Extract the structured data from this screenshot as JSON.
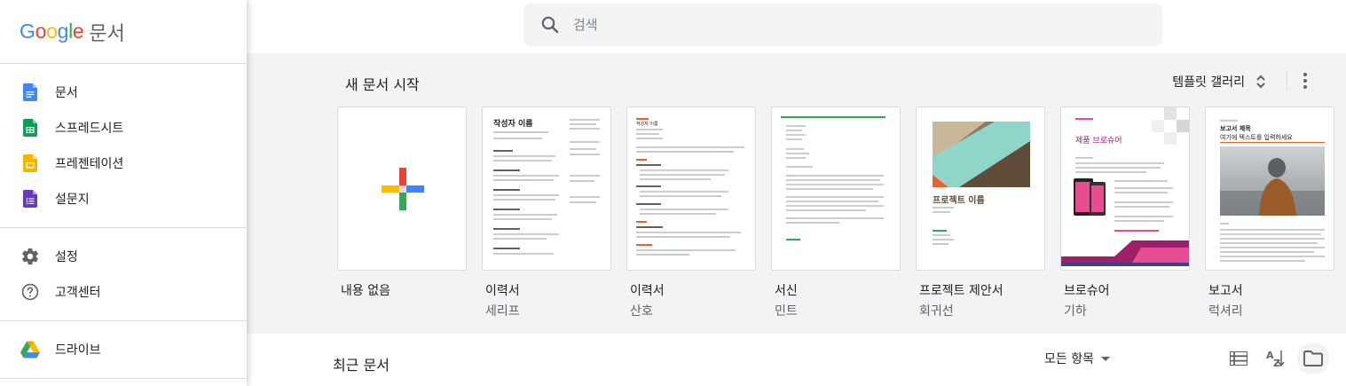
{
  "brand": {
    "logo_letters": [
      "G",
      "o",
      "o",
      "g",
      "l",
      "e"
    ],
    "logo_colors": [
      "#4285F4",
      "#EA4335",
      "#FBBC05",
      "#4285F4",
      "#34A853",
      "#EA4335"
    ],
    "product": "문서"
  },
  "sidebar": {
    "apps": [
      {
        "label": "문서",
        "icon": "docs-icon",
        "color": "#4285F4"
      },
      {
        "label": "스프레드시트",
        "icon": "sheets-icon",
        "color": "#0F9D58"
      },
      {
        "label": "프레젠테이션",
        "icon": "slides-icon",
        "color": "#F4B400"
      },
      {
        "label": "설문지",
        "icon": "forms-icon",
        "color": "#673AB7"
      }
    ],
    "settings": [
      {
        "label": "설정",
        "icon": "gear-icon"
      },
      {
        "label": "고객센터",
        "icon": "help-icon"
      }
    ],
    "drive": {
      "label": "드라이브",
      "icon": "drive-icon"
    }
  },
  "search": {
    "placeholder": "검색"
  },
  "templates": {
    "title": "새 문서 시작",
    "gallery_label": "템플릿 갤러리",
    "items": [
      {
        "name": "내용 없음",
        "sub": ""
      },
      {
        "name": "이력서",
        "sub": "세리프",
        "heading": "작성자 이름"
      },
      {
        "name": "이력서",
        "sub": "산호",
        "heading": "작성자 이름"
      },
      {
        "name": "서신",
        "sub": "민트"
      },
      {
        "name": "프로젝트 제안서",
        "sub": "회귀선",
        "heading": "프로젝트 이름"
      },
      {
        "name": "브로슈어",
        "sub": "기하",
        "heading": "제품 브로슈어"
      },
      {
        "name": "보고서",
        "sub": "럭셔리",
        "heading": "보고서 제목",
        "subheading": "여기에 텍스트를 입력하세요"
      }
    ]
  },
  "recent": {
    "title": "최근 문서",
    "owner_filter": "모든 항목"
  },
  "colors": {
    "accent_blue": "#4285F4",
    "template_bg": "#f1f3f4",
    "coral": "#e8622a",
    "mint": "#34a853"
  }
}
